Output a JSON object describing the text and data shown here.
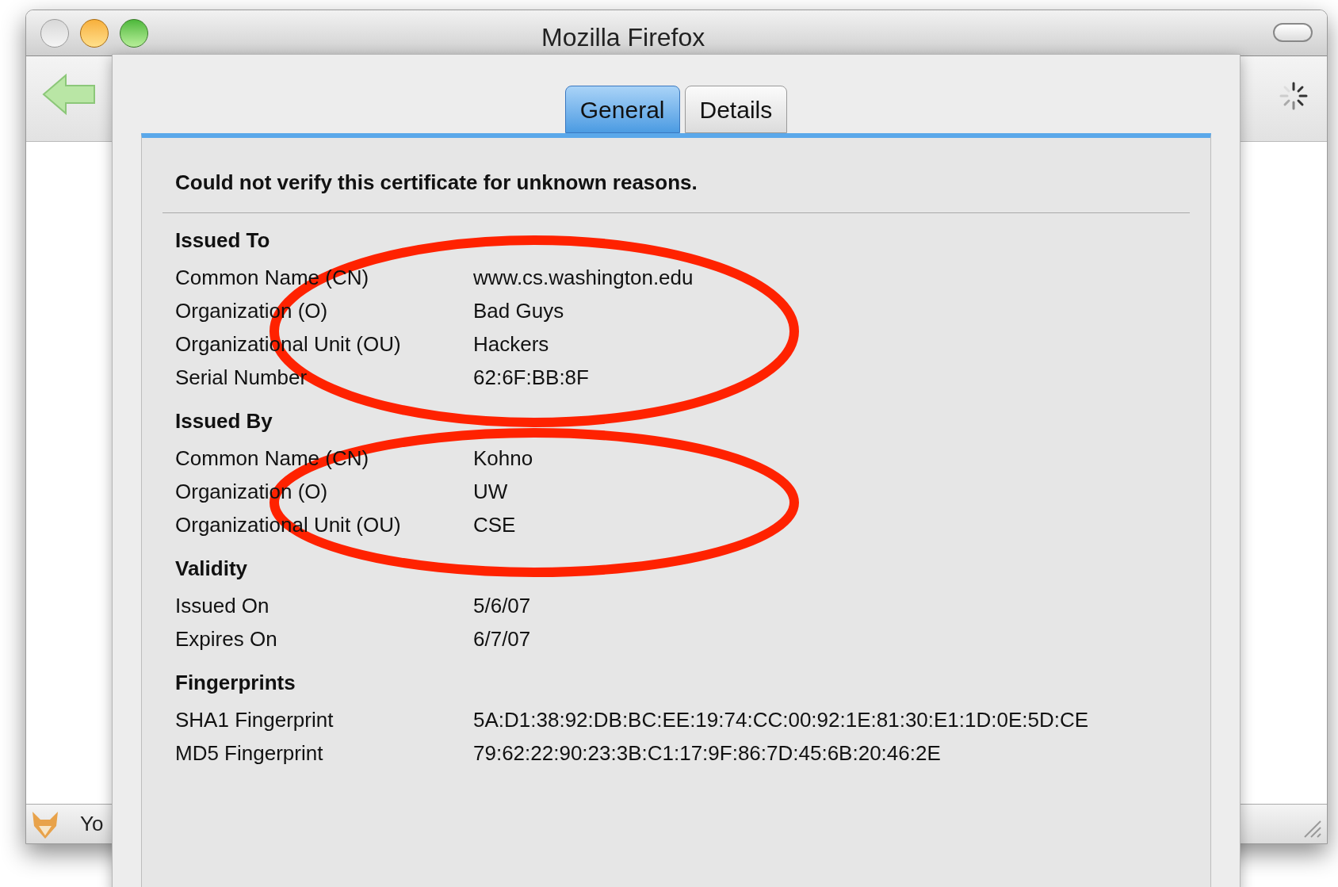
{
  "window": {
    "title": "Mozilla Firefox"
  },
  "status_bar": {
    "text": "Yo"
  },
  "dialog": {
    "tabs": [
      {
        "label": "General",
        "selected": true
      },
      {
        "label": "Details",
        "selected": false
      }
    ],
    "message": "Could not verify this certificate for unknown reasons.",
    "sections": [
      {
        "heading": "Issued To",
        "rows": [
          {
            "label": "Common Name (CN)",
            "value": "www.cs.washington.edu"
          },
          {
            "label": "Organization (O)",
            "value": "Bad Guys"
          },
          {
            "label": "Organizational Unit (OU)",
            "value": "Hackers"
          },
          {
            "label": "Serial Number",
            "value": "62:6F:BB:8F"
          }
        ],
        "annotation": {
          "kind": "ellipse"
        }
      },
      {
        "heading": "Issued By",
        "rows": [
          {
            "label": "Common Name (CN)",
            "value": "Kohno"
          },
          {
            "label": "Organization (O)",
            "value": "UW"
          },
          {
            "label": "Organizational Unit (OU)",
            "value": "CSE"
          }
        ],
        "annotation": {
          "kind": "ellipse"
        }
      },
      {
        "heading": "Validity",
        "rows": [
          {
            "label": "Issued On",
            "value": "5/6/07"
          },
          {
            "label": "Expires On",
            "value": "6/7/07"
          }
        ]
      },
      {
        "heading": "Fingerprints",
        "rows": [
          {
            "label": "SHA1 Fingerprint",
            "value": "5A:D1:38:92:DB:BC:EE:19:74:CC:00:92:1E:81:30:E1:1D:0E:5D:CE"
          },
          {
            "label": "MD5 Fingerprint",
            "value": "79:62:22:90:23:3B:C1:17:9F:86:7D:45:6B:20:46:2E"
          }
        ]
      }
    ]
  }
}
